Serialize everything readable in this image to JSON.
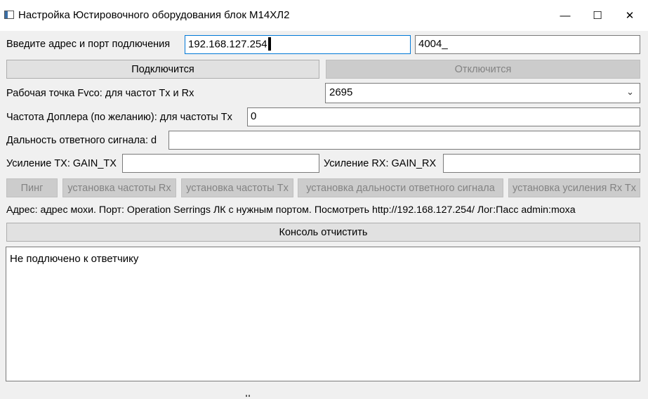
{
  "window": {
    "title": "Настройка Юстировочного оборудования блок М14ХЛ2",
    "minimize_glyph": "—",
    "maximize_glyph": "☐",
    "close_glyph": "✕"
  },
  "connection": {
    "label": "Введите адрес и порт подлючения",
    "address_value": "192.168.127.254",
    "port_value": "4004_",
    "connect_label": "Подключится",
    "disconnect_label": "Отключится"
  },
  "fvco": {
    "label": "Рабочая точка Fvco: для частот Tx и Rx",
    "selected": "2695"
  },
  "doppler": {
    "label": "Частота Доплера (по желанию): для частоты Tx",
    "value": "0"
  },
  "range": {
    "label": "Дальность ответного сигнала: d",
    "value": ""
  },
  "gain": {
    "tx_label": "Усиление TX: GAIN_TX",
    "tx_value": "",
    "rx_label": "Усиление RX: GAIN_RX",
    "rx_value": ""
  },
  "actions": {
    "ping": "Пинг",
    "set_rx_freq": "установка частоты Rx",
    "set_tx_freq": "установка частоты Tx",
    "set_range": "установка дальности ответного сигнала",
    "set_gain": "установка усиления Rx Tx"
  },
  "info_text": "Адрес: адрес мохи. Порт: Operation Serrings ЛК с нужным портом. Посмотреть http://192.168.127.254/ Лог:Пасс admin:moxa",
  "console": {
    "clear_label": "Консоль отчистить",
    "text": "Не подлючено к ответчику"
  }
}
